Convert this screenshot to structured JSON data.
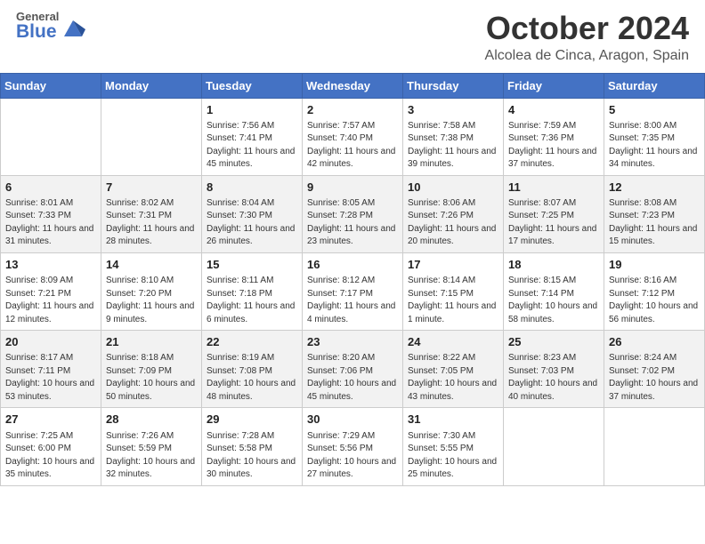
{
  "header": {
    "logo_line1": "General",
    "logo_line2": "Blue",
    "title": "October 2024",
    "subtitle": "Alcolea de Cinca, Aragon, Spain"
  },
  "days_of_week": [
    "Sunday",
    "Monday",
    "Tuesday",
    "Wednesday",
    "Thursday",
    "Friday",
    "Saturday"
  ],
  "weeks": [
    [
      {
        "day": "",
        "info": ""
      },
      {
        "day": "",
        "info": ""
      },
      {
        "day": "1",
        "info": "Sunrise: 7:56 AM\nSunset: 7:41 PM\nDaylight: 11 hours and 45 minutes."
      },
      {
        "day": "2",
        "info": "Sunrise: 7:57 AM\nSunset: 7:40 PM\nDaylight: 11 hours and 42 minutes."
      },
      {
        "day": "3",
        "info": "Sunrise: 7:58 AM\nSunset: 7:38 PM\nDaylight: 11 hours and 39 minutes."
      },
      {
        "day": "4",
        "info": "Sunrise: 7:59 AM\nSunset: 7:36 PM\nDaylight: 11 hours and 37 minutes."
      },
      {
        "day": "5",
        "info": "Sunrise: 8:00 AM\nSunset: 7:35 PM\nDaylight: 11 hours and 34 minutes."
      }
    ],
    [
      {
        "day": "6",
        "info": "Sunrise: 8:01 AM\nSunset: 7:33 PM\nDaylight: 11 hours and 31 minutes."
      },
      {
        "day": "7",
        "info": "Sunrise: 8:02 AM\nSunset: 7:31 PM\nDaylight: 11 hours and 28 minutes."
      },
      {
        "day": "8",
        "info": "Sunrise: 8:04 AM\nSunset: 7:30 PM\nDaylight: 11 hours and 26 minutes."
      },
      {
        "day": "9",
        "info": "Sunrise: 8:05 AM\nSunset: 7:28 PM\nDaylight: 11 hours and 23 minutes."
      },
      {
        "day": "10",
        "info": "Sunrise: 8:06 AM\nSunset: 7:26 PM\nDaylight: 11 hours and 20 minutes."
      },
      {
        "day": "11",
        "info": "Sunrise: 8:07 AM\nSunset: 7:25 PM\nDaylight: 11 hours and 17 minutes."
      },
      {
        "day": "12",
        "info": "Sunrise: 8:08 AM\nSunset: 7:23 PM\nDaylight: 11 hours and 15 minutes."
      }
    ],
    [
      {
        "day": "13",
        "info": "Sunrise: 8:09 AM\nSunset: 7:21 PM\nDaylight: 11 hours and 12 minutes."
      },
      {
        "day": "14",
        "info": "Sunrise: 8:10 AM\nSunset: 7:20 PM\nDaylight: 11 hours and 9 minutes."
      },
      {
        "day": "15",
        "info": "Sunrise: 8:11 AM\nSunset: 7:18 PM\nDaylight: 11 hours and 6 minutes."
      },
      {
        "day": "16",
        "info": "Sunrise: 8:12 AM\nSunset: 7:17 PM\nDaylight: 11 hours and 4 minutes."
      },
      {
        "day": "17",
        "info": "Sunrise: 8:14 AM\nSunset: 7:15 PM\nDaylight: 11 hours and 1 minute."
      },
      {
        "day": "18",
        "info": "Sunrise: 8:15 AM\nSunset: 7:14 PM\nDaylight: 10 hours and 58 minutes."
      },
      {
        "day": "19",
        "info": "Sunrise: 8:16 AM\nSunset: 7:12 PM\nDaylight: 10 hours and 56 minutes."
      }
    ],
    [
      {
        "day": "20",
        "info": "Sunrise: 8:17 AM\nSunset: 7:11 PM\nDaylight: 10 hours and 53 minutes."
      },
      {
        "day": "21",
        "info": "Sunrise: 8:18 AM\nSunset: 7:09 PM\nDaylight: 10 hours and 50 minutes."
      },
      {
        "day": "22",
        "info": "Sunrise: 8:19 AM\nSunset: 7:08 PM\nDaylight: 10 hours and 48 minutes."
      },
      {
        "day": "23",
        "info": "Sunrise: 8:20 AM\nSunset: 7:06 PM\nDaylight: 10 hours and 45 minutes."
      },
      {
        "day": "24",
        "info": "Sunrise: 8:22 AM\nSunset: 7:05 PM\nDaylight: 10 hours and 43 minutes."
      },
      {
        "day": "25",
        "info": "Sunrise: 8:23 AM\nSunset: 7:03 PM\nDaylight: 10 hours and 40 minutes."
      },
      {
        "day": "26",
        "info": "Sunrise: 8:24 AM\nSunset: 7:02 PM\nDaylight: 10 hours and 37 minutes."
      }
    ],
    [
      {
        "day": "27",
        "info": "Sunrise: 7:25 AM\nSunset: 6:00 PM\nDaylight: 10 hours and 35 minutes."
      },
      {
        "day": "28",
        "info": "Sunrise: 7:26 AM\nSunset: 5:59 PM\nDaylight: 10 hours and 32 minutes."
      },
      {
        "day": "29",
        "info": "Sunrise: 7:28 AM\nSunset: 5:58 PM\nDaylight: 10 hours and 30 minutes."
      },
      {
        "day": "30",
        "info": "Sunrise: 7:29 AM\nSunset: 5:56 PM\nDaylight: 10 hours and 27 minutes."
      },
      {
        "day": "31",
        "info": "Sunrise: 7:30 AM\nSunset: 5:55 PM\nDaylight: 10 hours and 25 minutes."
      },
      {
        "day": "",
        "info": ""
      },
      {
        "day": "",
        "info": ""
      }
    ]
  ]
}
